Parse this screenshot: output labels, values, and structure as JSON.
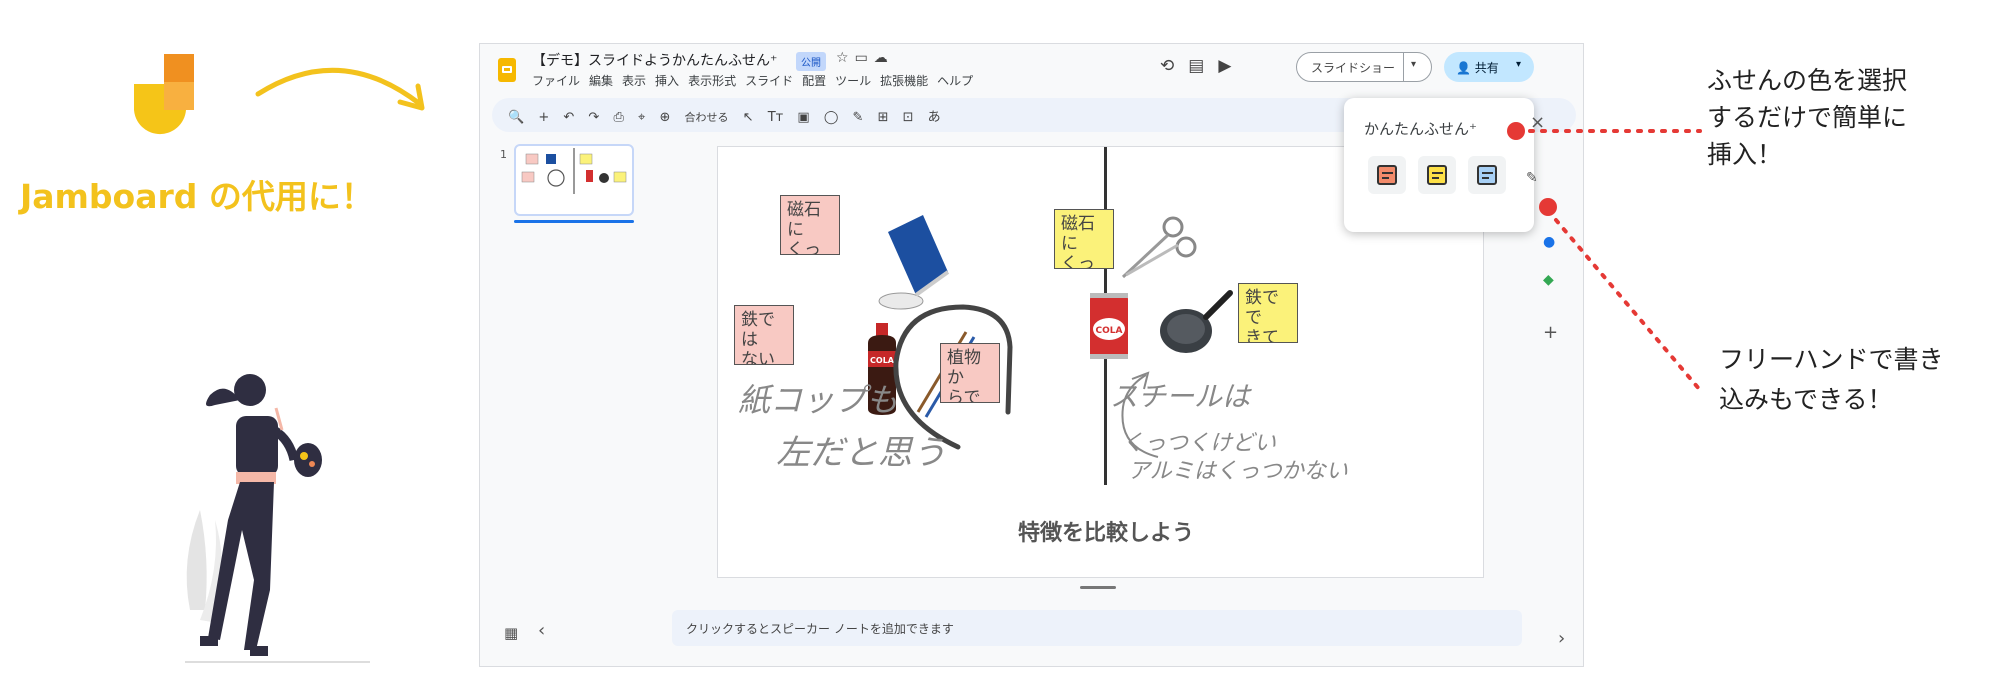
{
  "promo": {
    "title": "Jamboard の代用に！",
    "accent": "#f3c21d"
  },
  "app": {
    "doc_title": "【デモ】スライドようかんたんふせん⁺",
    "public_badge": "公開",
    "title_icons": [
      "star-icon",
      "folder-move-icon",
      "cloud-status-icon"
    ],
    "menu": [
      "ファイル",
      "編集",
      "表示",
      "挿入",
      "表示形式",
      "スライド",
      "配置",
      "ツール",
      "拡張機能",
      "ヘルプ"
    ],
    "header_icons": [
      "history-icon",
      "comment-icon",
      "meet-icon"
    ],
    "slideshow_label": "スライドショー",
    "share_label": "共有",
    "toolbar": {
      "zoom_label": "合わせる",
      "glyphs": [
        "🔍",
        "+",
        "↶",
        "↷",
        "⎙",
        "⌖",
        "⊕",
        "↖",
        "Tт",
        "▣",
        "◯",
        "✎",
        "⊞",
        "⊡",
        "あ"
      ]
    },
    "thumbnail_number": "1",
    "speaker_notes_placeholder": "クリックするとスピーカー ノートを追加できます"
  },
  "slide": {
    "notes_left": [
      {
        "text": "磁石に\nくっつ\nかない",
        "color": "#f8c9c3"
      },
      {
        "text": "鉄では\nない",
        "color": "#f8c9c3"
      },
      {
        "text": "植物か\nらでき\nている",
        "color": "#f8c9c3"
      }
    ],
    "notes_right": [
      {
        "text": "磁石に\nくっつ\nく",
        "color": "#fbf27a"
      },
      {
        "text": "鉄でで\nきてい\nる",
        "color": "#fbf27a"
      }
    ],
    "cola_label": "COLA",
    "handwriting": [
      "紙コップも",
      "左だと思う",
      "スチールは",
      "くっつくけどい",
      "アルミはくっつかない"
    ],
    "compare_title": "特徴を比較しよう"
  },
  "popover": {
    "title": "かんたんふせん⁺",
    "colors": [
      "#f28b6b",
      "#fde047",
      "#a8d0f5"
    ]
  },
  "callouts": {
    "color_select": [
      "ふせんの色を選択",
      "するだけで簡単に",
      "挿入！"
    ],
    "freehand": [
      "フリーハンドで書き",
      "込みもできる！"
    ],
    "marker_color": "#e53935"
  }
}
